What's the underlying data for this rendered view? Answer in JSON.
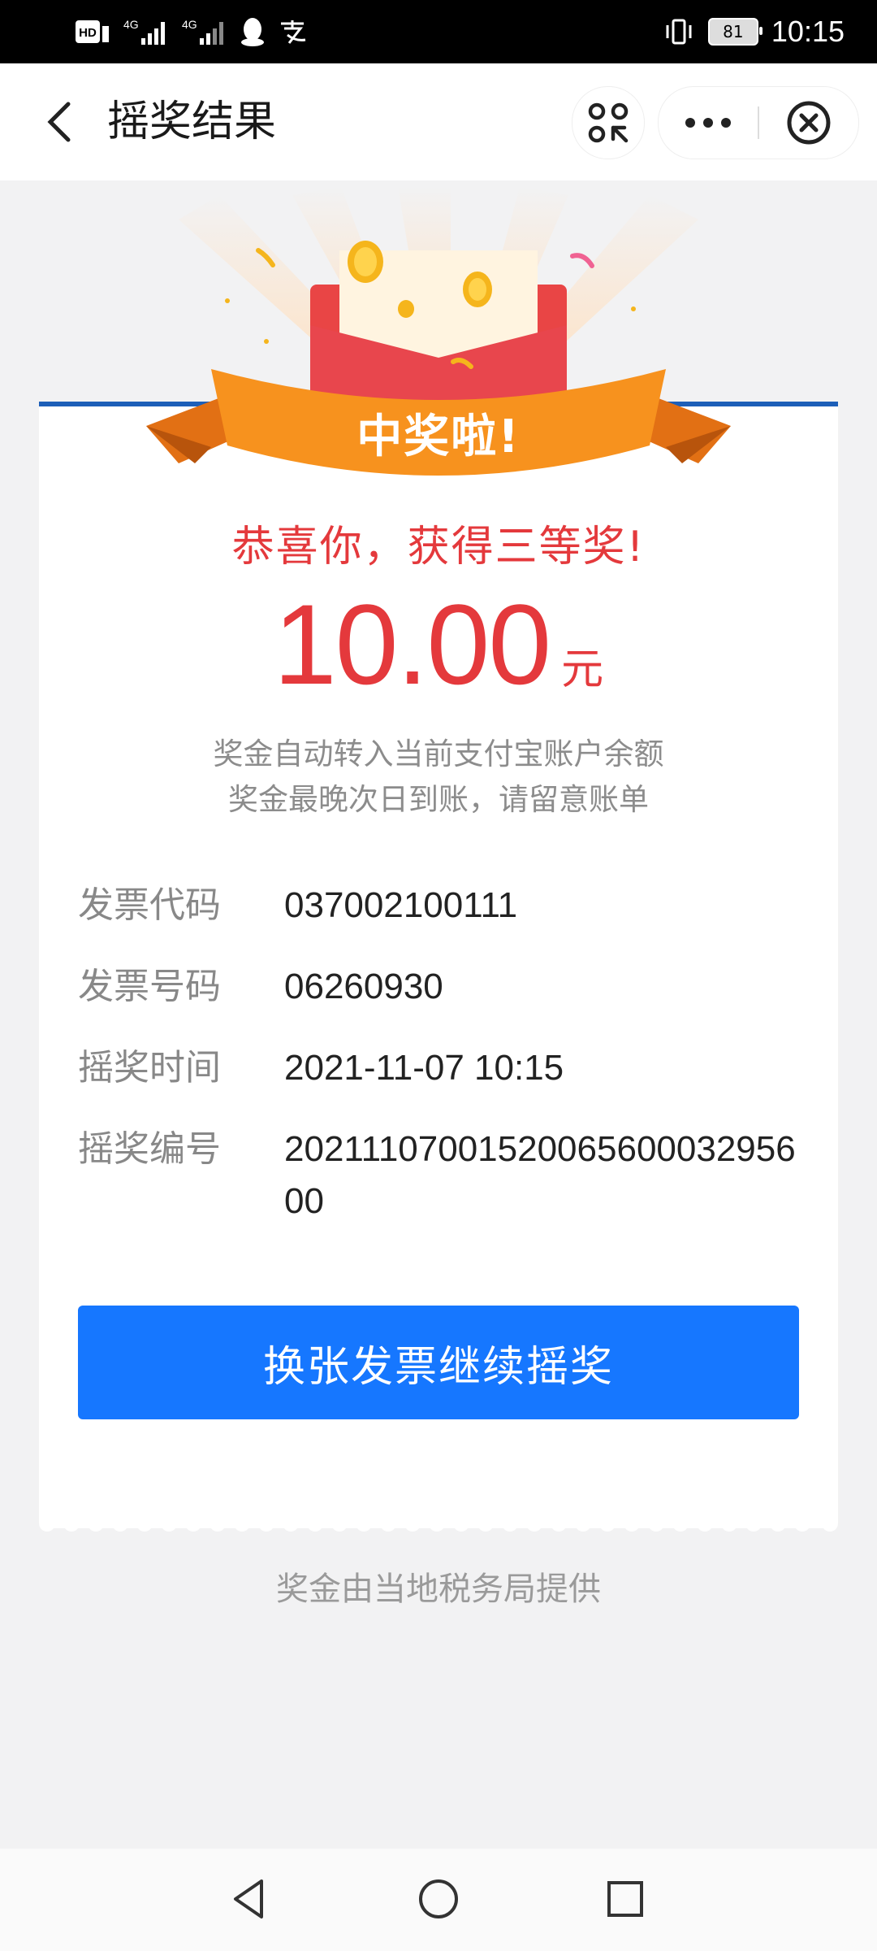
{
  "status_bar": {
    "left_icons": [
      "hd-icon",
      "signal-4g-icon",
      "signal-4g-icon",
      "qq-icon",
      "alipay-icon"
    ],
    "battery_level": "81",
    "time": "10:15"
  },
  "nav": {
    "title": "摇奖结果"
  },
  "banner": {
    "text": "中奖啦!"
  },
  "result": {
    "congrats": "恭喜你，获得三等奖!",
    "amount": "10.00",
    "unit": "元",
    "note_line1": "奖金自动转入当前支付宝账户余额",
    "note_line2": "奖金最晚次日到账，请留意账单"
  },
  "info_rows": [
    {
      "label": "发票代码",
      "value": "037002100111"
    },
    {
      "label": "发票号码",
      "value": "06260930"
    },
    {
      "label": "摇奖时间",
      "value": "2021-11-07 10:15"
    },
    {
      "label": "摇奖编号",
      "value": "2021110700152006560003295600"
    }
  ],
  "action_button": "换张发票继续摇奖",
  "footer_note": "奖金由当地税务局提供",
  "colors": {
    "accent_red": "#e4393c",
    "primary_blue": "#1677ff",
    "banner_orange": "#f7921e"
  }
}
